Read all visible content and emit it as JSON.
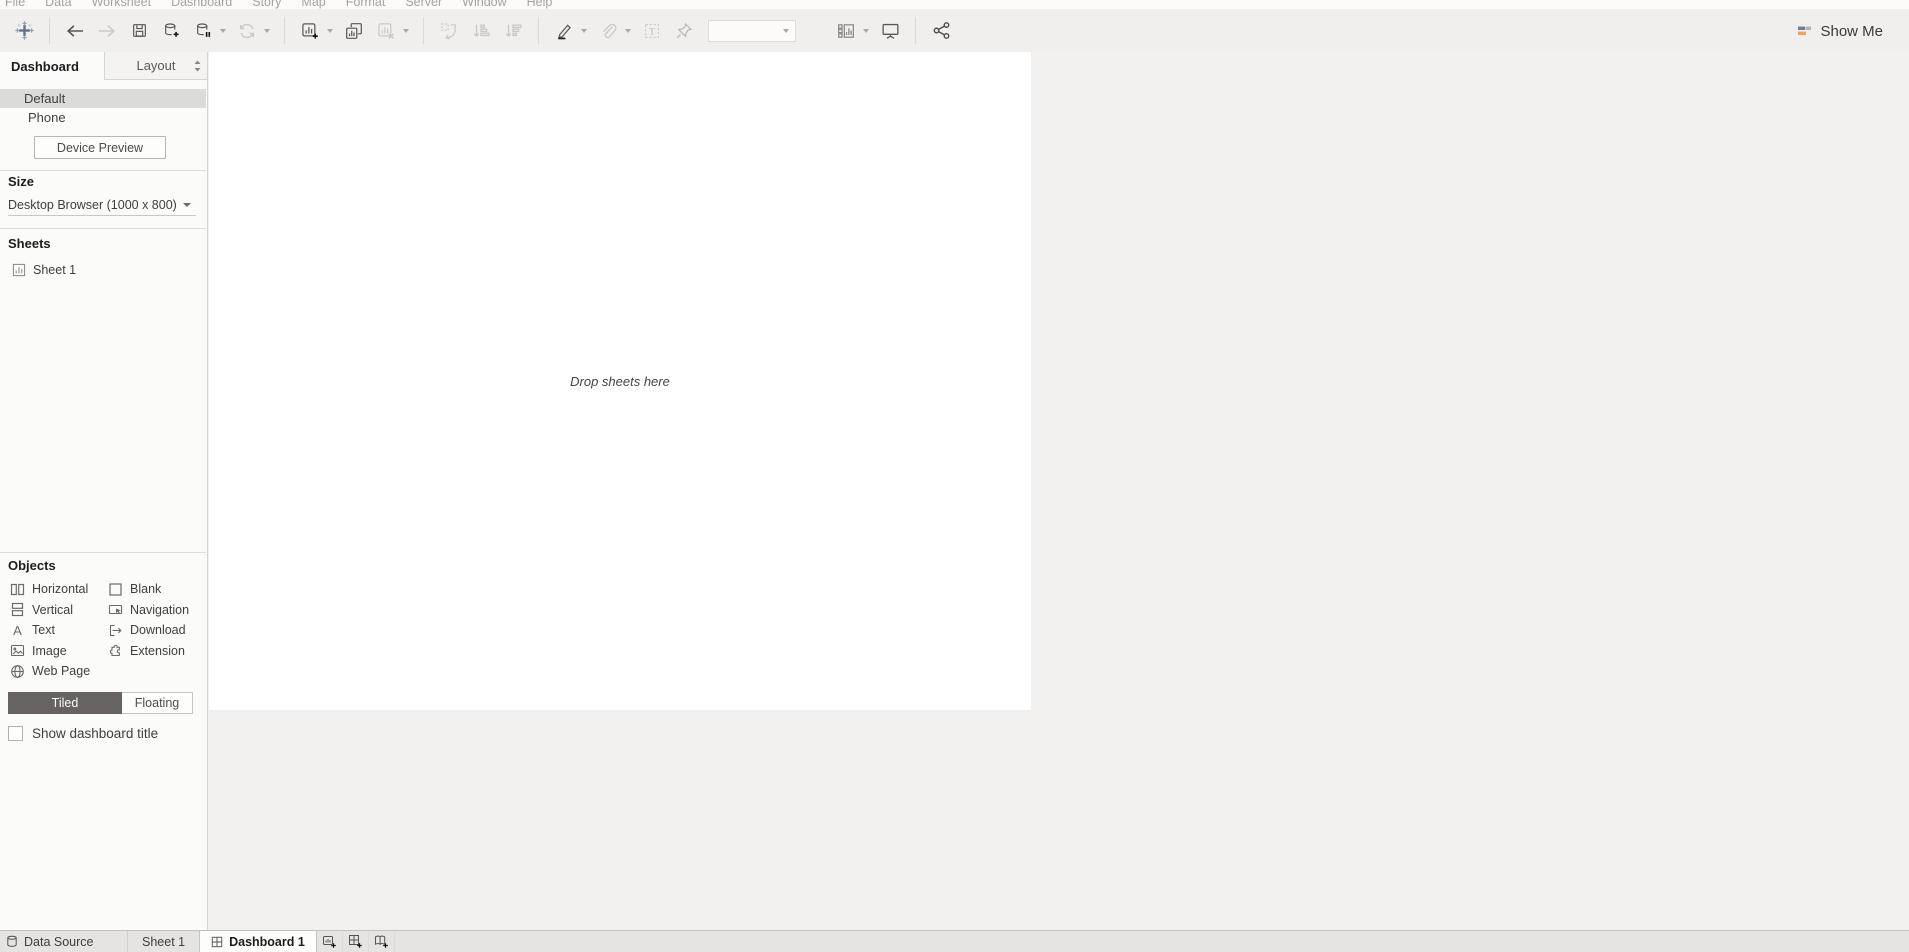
{
  "menu_bar": {
    "items": [
      "File",
      "Data",
      "Worksheet",
      "Dashboard",
      "Story",
      "Map",
      "Format",
      "Server",
      "Window",
      "Help"
    ]
  },
  "toolbar": {
    "show_me_label": "Show Me",
    "fit_dropdown_value": "",
    "icons": [
      "tableau-logo",
      "undo",
      "redo",
      "save",
      "new-data-source",
      "pause-auto-updates",
      "run-auto-updates",
      "new-worksheet",
      "duplicate",
      "clear-sheet",
      "swap-rows-columns",
      "sort-ascending",
      "sort-descending",
      "highlight",
      "annotation",
      "format-text",
      "pin",
      "show-hide-cards",
      "presentation-mode",
      "share"
    ]
  },
  "sidebar": {
    "tabs": {
      "dashboard": "Dashboard",
      "layout": "Layout"
    },
    "devices": [
      {
        "label": "Default",
        "selected": true
      },
      {
        "label": "Phone",
        "selected": false
      }
    ],
    "device_preview_button": "Device Preview",
    "size_section": {
      "heading": "Size",
      "selected_value": "Desktop Browser (1000 x 800)"
    },
    "sheets_section": {
      "heading": "Sheets",
      "sheets": [
        {
          "label": "Sheet 1"
        }
      ]
    },
    "objects_section": {
      "heading": "Objects",
      "items": [
        {
          "label": "Horizontal",
          "icon": "horizontal-icon"
        },
        {
          "label": "Vertical",
          "icon": "vertical-icon"
        },
        {
          "label": "Text",
          "icon": "text-icon"
        },
        {
          "label": "Image",
          "icon": "image-icon"
        },
        {
          "label": "Web Page",
          "icon": "web-page-icon"
        },
        {
          "label": "Blank",
          "icon": "blank-icon"
        },
        {
          "label": "Navigation",
          "icon": "navigation-icon"
        },
        {
          "label": "Download",
          "icon": "download-icon"
        },
        {
          "label": "Extension",
          "icon": "extension-icon"
        }
      ]
    },
    "layout_mode": {
      "tiled": "Tiled",
      "floating": "Floating",
      "selected": "Tiled"
    },
    "show_dashboard_title": {
      "label": "Show dashboard title",
      "checked": false
    }
  },
  "canvas": {
    "drop_hint": "Drop sheets here"
  },
  "sheet_tabs_bar": {
    "data_source_label": "Data Source",
    "tabs": [
      {
        "label": "Sheet 1",
        "active": false
      },
      {
        "label": "Dashboard 1",
        "active": true
      }
    ],
    "new_buttons": [
      "new-worksheet-button",
      "new-dashboard-button",
      "new-story-button"
    ]
  },
  "colors": {
    "toolbar_bg": "#f0efed",
    "workspace_bg": "#f1f0ee",
    "canvas_bg": "#ffffff",
    "selected_device_bg": "#dcdbd9",
    "tiled_selected_bg": "#666361",
    "tabbar_bg": "#e5e4e2",
    "show_me_bar_slate": "#7d8b9c",
    "show_me_bar_orange": "#f2a35e",
    "logo_blue": "#607486"
  }
}
